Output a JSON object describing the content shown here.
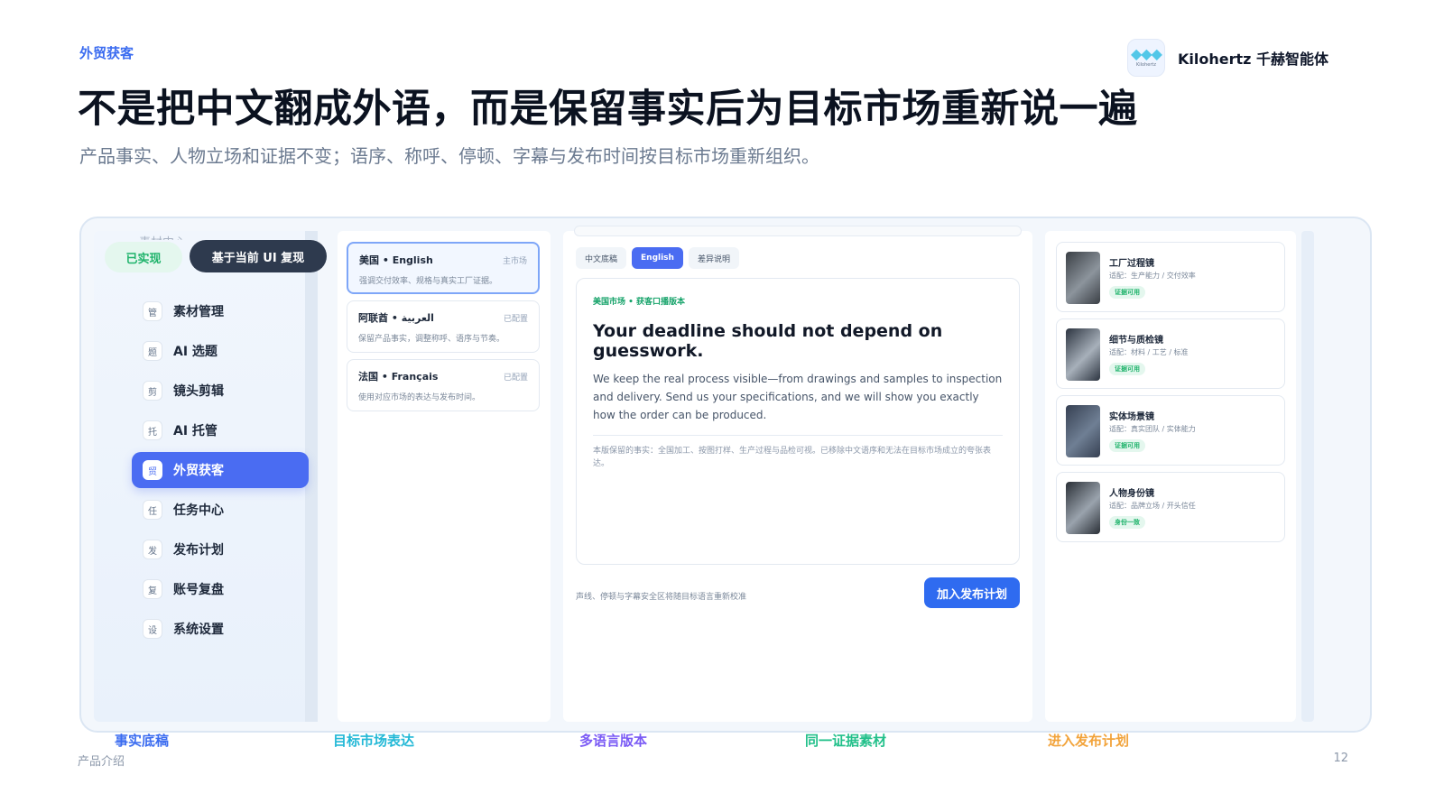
{
  "header": {
    "eyebrow": "外贸获客",
    "brand_name": "Kilohertz 千赫智能体",
    "logo_text": "Kilohertz",
    "headline": "不是把中文翻成外语，而是保留事实后为目标市场重新说一遍",
    "subhead": "产品事实、人物立场和证据不变；语序、称呼、停顿、字幕与发布时间按目标市场重新组织。"
  },
  "overlay": {
    "done_badge": "已实现",
    "ui_badge": "基于当前 UI 复现"
  },
  "sidebar": {
    "cut_item": "素材中心",
    "items": [
      {
        "icon": "管",
        "label": "素材管理",
        "active": false
      },
      {
        "icon": "题",
        "label": "AI 选题",
        "active": false
      },
      {
        "icon": "剪",
        "label": "镜头剪辑",
        "active": false
      },
      {
        "icon": "托",
        "label": "AI 托管",
        "active": false
      },
      {
        "icon": "贸",
        "label": "外贸获客",
        "active": true
      },
      {
        "icon": "任",
        "label": "任务中心",
        "active": false
      },
      {
        "icon": "发",
        "label": "发布计划",
        "active": false
      },
      {
        "icon": "复",
        "label": "账号复盘",
        "active": false
      },
      {
        "icon": "设",
        "label": "系统设置",
        "active": false
      }
    ]
  },
  "languages": [
    {
      "name": "美国 • English",
      "status": "主市场",
      "desc": "强调交付效率、规格与真实工厂证据。"
    },
    {
      "name": "阿联酋 • العربية",
      "status": "已配置",
      "desc": "保留产品事实，调整称呼、语序与节奏。"
    },
    {
      "name": "法国 • Français",
      "status": "已配置",
      "desc": "使用对应市场的表达与发布时间。"
    }
  ],
  "main": {
    "tabs": [
      "中文底稿",
      "English",
      "差异说明"
    ],
    "active_tab": "English",
    "doc_tag": "美国市场 • 获客口播版本",
    "doc_title": "Your deadline should not depend on guesswork.",
    "doc_body": "We keep the real process visible—from drawings and samples to inspection and delivery. Send us your specifications, and we will show you exactly how the order can be produced.",
    "doc_note": "本版保留的事实：全国加工、按图打样、生产过程与品检可视。已移除中文语序和无法在目标市场成立的夸张表达。",
    "footer_note": "声线、停顿与字幕安全区将随目标语言重新校准",
    "add_button": "加入发布计划"
  },
  "evidence": [
    {
      "title": "工厂过程镜",
      "meta": "适配：生产能力 / 交付效率",
      "badge": "证据可用",
      "thumb": [
        "#3a3f45",
        "#8c949c"
      ]
    },
    {
      "title": "细节与质检镜",
      "meta": "适配：材料 / 工艺 / 标准",
      "badge": "证据可用",
      "thumb": [
        "#2c3440",
        "#a7b0ba"
      ]
    },
    {
      "title": "实体场景镜",
      "meta": "适配：真实团队 / 实体能力",
      "badge": "证据可用",
      "thumb": [
        "#364052",
        "#6f7f94"
      ]
    },
    {
      "title": "人物身份镜",
      "meta": "适配：品牌立场 / 开头信任",
      "badge": "身份一致",
      "thumb": [
        "#2a2f36",
        "#9aa3ad"
      ]
    }
  ],
  "steps": [
    {
      "label": "事实底稿",
      "color": "#3b6cf0"
    },
    {
      "label": "目标市场表达",
      "color": "#22b8d6"
    },
    {
      "label": "多语言版本",
      "color": "#7a5af5"
    },
    {
      "label": "同一证据素材",
      "color": "#22c08a"
    },
    {
      "label": "进入发布计划",
      "color": "#f2a33a"
    }
  ],
  "footer": {
    "left": "产品介绍",
    "page": "12"
  }
}
